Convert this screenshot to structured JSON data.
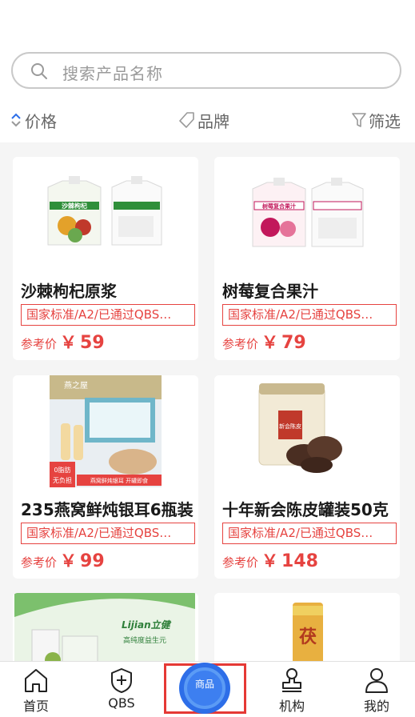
{
  "search": {
    "placeholder": "搜索产品名称"
  },
  "filters": {
    "price": "价格",
    "brand": "品牌",
    "filter": "筛选"
  },
  "products": [
    {
      "title": "沙棘枸杞原浆",
      "tag": "国家标准/A2/已通过QBS…",
      "price_label": "参考价",
      "currency": "￥",
      "price": "59"
    },
    {
      "title": "树莓复合果汁",
      "tag": "国家标准/A2/已通过QBS…",
      "price_label": "参考价",
      "currency": "￥",
      "price": "79"
    },
    {
      "title": "235燕窝鲜炖银耳6瓶装",
      "tag": "国家标准/A2/已通过QBS…",
      "price_label": "参考价",
      "currency": "￥",
      "price": "99"
    },
    {
      "title": "十年新会陈皮罐装50克",
      "tag": "国家标准/A2/已通过QBS…",
      "price_label": "参考价",
      "currency": "￥",
      "price": "148"
    }
  ],
  "product_images": {
    "p1_label": "沙棘枸杞",
    "p2_label": "树莓复合果汁",
    "p3_badge_top": "0脂肪",
    "p3_badge_bottom": "无负担",
    "p3_banner": "燕窝鲜炖银耳 开罐即食",
    "p3_brand": "燕之屋",
    "p4_label": "新会陈皮",
    "p5_brand": "Lijian立健",
    "p5_line": "高纯度益生元",
    "p6_label": "茯"
  },
  "nav": {
    "home": "首页",
    "qbs": "QBS",
    "products": "商品",
    "org": "机构",
    "mine": "我的"
  },
  "colors": {
    "accent": "#e64340",
    "brand_blue": "#2d6ee8"
  }
}
